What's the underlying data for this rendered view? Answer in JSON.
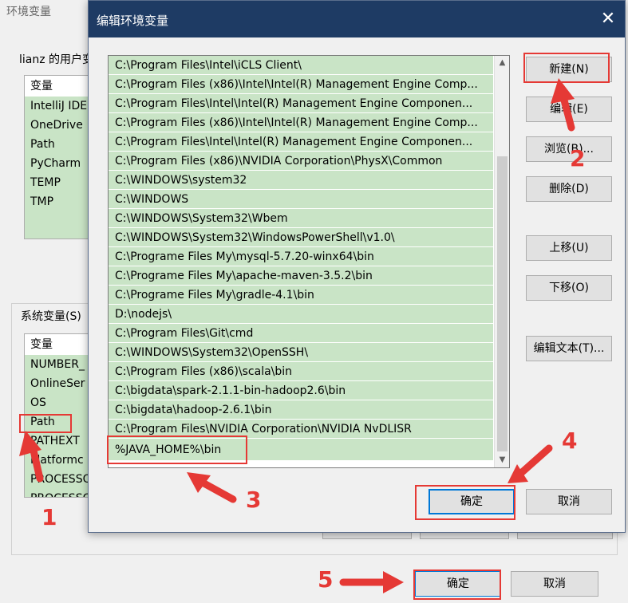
{
  "background": {
    "title": "环境变量",
    "user_vars_label": "lianz 的用户变",
    "user_list": {
      "header": "变量",
      "items": [
        "IntelliJ IDE",
        "OneDrive",
        "Path",
        "PyCharm",
        "TEMP",
        "TMP"
      ]
    },
    "system_vars_label": "系统变量(S)",
    "system_list": {
      "header": "变量",
      "items": [
        "NUMBER_",
        "OnlineSer",
        "OS",
        "Path",
        "PATHEXT",
        "Platformc",
        "PROCESSO",
        "PROCESSO"
      ]
    },
    "ok_button": "确定",
    "cancel_button": "取消"
  },
  "dialog": {
    "title": "编辑环境变量",
    "close_glyph": "✕",
    "paths": [
      "C:\\Program Files\\Intel\\iCLS Client\\",
      "C:\\Program Files (x86)\\Intel\\Intel(R) Management Engine Comp...",
      "C:\\Program Files\\Intel\\Intel(R) Management Engine Componen...",
      "C:\\Program Files (x86)\\Intel\\Intel(R) Management Engine Comp...",
      "C:\\Program Files\\Intel\\Intel(R) Management Engine Componen...",
      "C:\\Program Files (x86)\\NVIDIA Corporation\\PhysX\\Common",
      "C:\\WINDOWS\\system32",
      "C:\\WINDOWS",
      "C:\\WINDOWS\\System32\\Wbem",
      "C:\\WINDOWS\\System32\\WindowsPowerShell\\v1.0\\",
      "C:\\Programe Files My\\mysql-5.7.20-winx64\\bin",
      "C:\\Programe Files My\\apache-maven-3.5.2\\bin",
      "C:\\Programe Files My\\gradle-4.1\\bin",
      "D:\\nodejs\\",
      "C:\\Program Files\\Git\\cmd",
      "C:\\WINDOWS\\System32\\OpenSSH\\",
      "C:\\Program Files (x86)\\scala\\bin",
      "C:\\bigdata\\spark-2.1.1-bin-hadoop2.6\\bin",
      "C:\\bigdata\\hadoop-2.6.1\\bin",
      "C:\\Program Files\\NVIDIA Corporation\\NVIDIA NvDLISR"
    ],
    "new_entry": "%JAVA_HOME%\\bin",
    "buttons": {
      "new": "新建(N)",
      "edit": "编辑(E)",
      "browse": "浏览(B)...",
      "delete": "删除(D)",
      "move_up": "上移(U)",
      "move_down": "下移(O)",
      "edit_text": "编辑文本(T)...",
      "ok": "确定",
      "cancel": "取消"
    },
    "scroll_up_glyph": "▲",
    "scroll_down_glyph": "▼"
  },
  "annotations": {
    "color": "#e53935",
    "numbers": [
      "1",
      "2",
      "3",
      "4",
      "5"
    ]
  }
}
